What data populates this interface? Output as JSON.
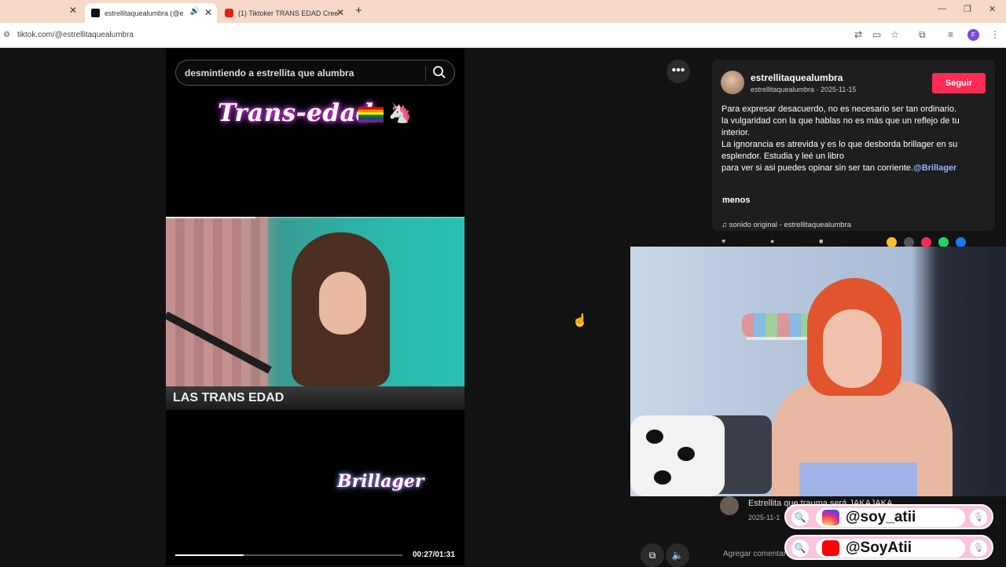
{
  "browser": {
    "tabs": [
      {
        "title": "estrellitaquealumbra (@estrellitaquealumbra)"
      },
      {
        "title": "(1) Tiktoker TRANS EDAD Cree"
      }
    ],
    "url": "tiktok.com/@estrellitaquealumbra"
  },
  "search": {
    "query": "desmintiendo a estrellita que alumbra"
  },
  "video": {
    "overlay_title": "Trans-edad",
    "caption": "LAS TRANS EDAD",
    "watermark": "Brillager",
    "time": "00:27/01:31",
    "progress": 0.3
  },
  "post": {
    "username": "estrellitaquealumbra",
    "meta": "estrellitaquealumbra · 2025-11-15",
    "follow_label": "Seguir",
    "description": [
      "Para expresar desacuerdo, no es necesario ser tan ordinario.",
      "la vulgaridad con la que hablas no es más que un reflejo de tu",
      "interior.",
      "La ignorancia es atrevida y es lo que desborda brillager en su",
      "esplendor. Estudia y leé un libro"
    ],
    "last_line": "para ver si asi puedes opinar sin ser tan corriente.",
    "mention": "@Brillager",
    "less_label": "menos",
    "sound": "sonido original - estrellitaquealumbra",
    "colors": {
      "follow": "#fe2c55",
      "mention": "#8fb4ff"
    }
  },
  "comment": {
    "text": "Estrellita que trauma será JAKAJAKA",
    "date": "2025-11-1"
  },
  "comment_input": {
    "placeholder": "Agregar comentar"
  },
  "social": {
    "instagram": "@soy_atii",
    "youtube": "@SoyAtii"
  }
}
